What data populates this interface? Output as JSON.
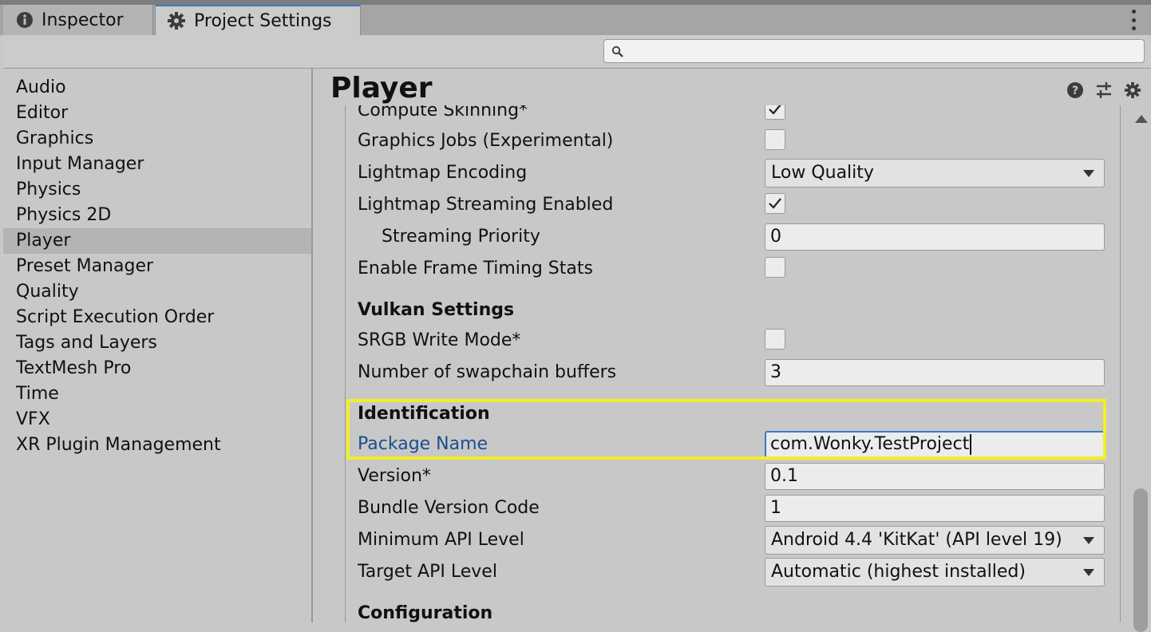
{
  "tabs": {
    "inspector": "Inspector",
    "project_settings": "Project Settings"
  },
  "search": {
    "value": "",
    "placeholder": ""
  },
  "sidebar": {
    "items": [
      "Audio",
      "Editor",
      "Graphics",
      "Input Manager",
      "Physics",
      "Physics 2D",
      "Player",
      "Preset Manager",
      "Quality",
      "Script Execution Order",
      "Tags and Layers",
      "TextMesh Pro",
      "Time",
      "VFX",
      "XR Plugin Management"
    ],
    "selected": "Player"
  },
  "main": {
    "title": "Player",
    "rows": {
      "compute_skinning": {
        "label": "Compute Skinning*",
        "checked": true
      },
      "graphics_jobs": {
        "label": "Graphics Jobs (Experimental)",
        "checked": false
      },
      "lightmap_encoding": {
        "label": "Lightmap Encoding",
        "value": "Low Quality"
      },
      "lightmap_streaming": {
        "label": "Lightmap Streaming Enabled",
        "checked": true
      },
      "streaming_priority": {
        "label": "Streaming Priority",
        "value": "0"
      },
      "frame_timing": {
        "label": "Enable Frame Timing Stats",
        "checked": false
      },
      "srgb_write": {
        "label": "SRGB Write Mode*",
        "checked": false
      },
      "swapchain": {
        "label": "Number of swapchain buffers",
        "value": "3"
      },
      "package_name": {
        "label": "Package Name",
        "value": "com.Wonky.TestProject"
      },
      "version": {
        "label": "Version*",
        "value": "0.1"
      },
      "bundle_version": {
        "label": "Bundle Version Code",
        "value": "1"
      },
      "min_api": {
        "label": "Minimum API Level",
        "value": "Android 4.4 'KitKat' (API level 19)"
      },
      "target_api": {
        "label": "Target API Level",
        "value": "Automatic (highest installed)"
      }
    },
    "sections": {
      "vulkan": "Vulkan Settings",
      "identification": "Identification",
      "configuration": "Configuration"
    }
  },
  "colors": {
    "highlight": "#f2ee2a",
    "focus": "#3a79c8",
    "link_label": "#1b4e8e"
  },
  "icons": [
    "info-icon",
    "gear-icon",
    "kebab-menu-icon",
    "search-icon",
    "help-icon",
    "sliders-icon",
    "settings-gear-icon",
    "checkmark-icon",
    "dropdown-arrow-icon",
    "scroll-up-arrow-icon"
  ]
}
